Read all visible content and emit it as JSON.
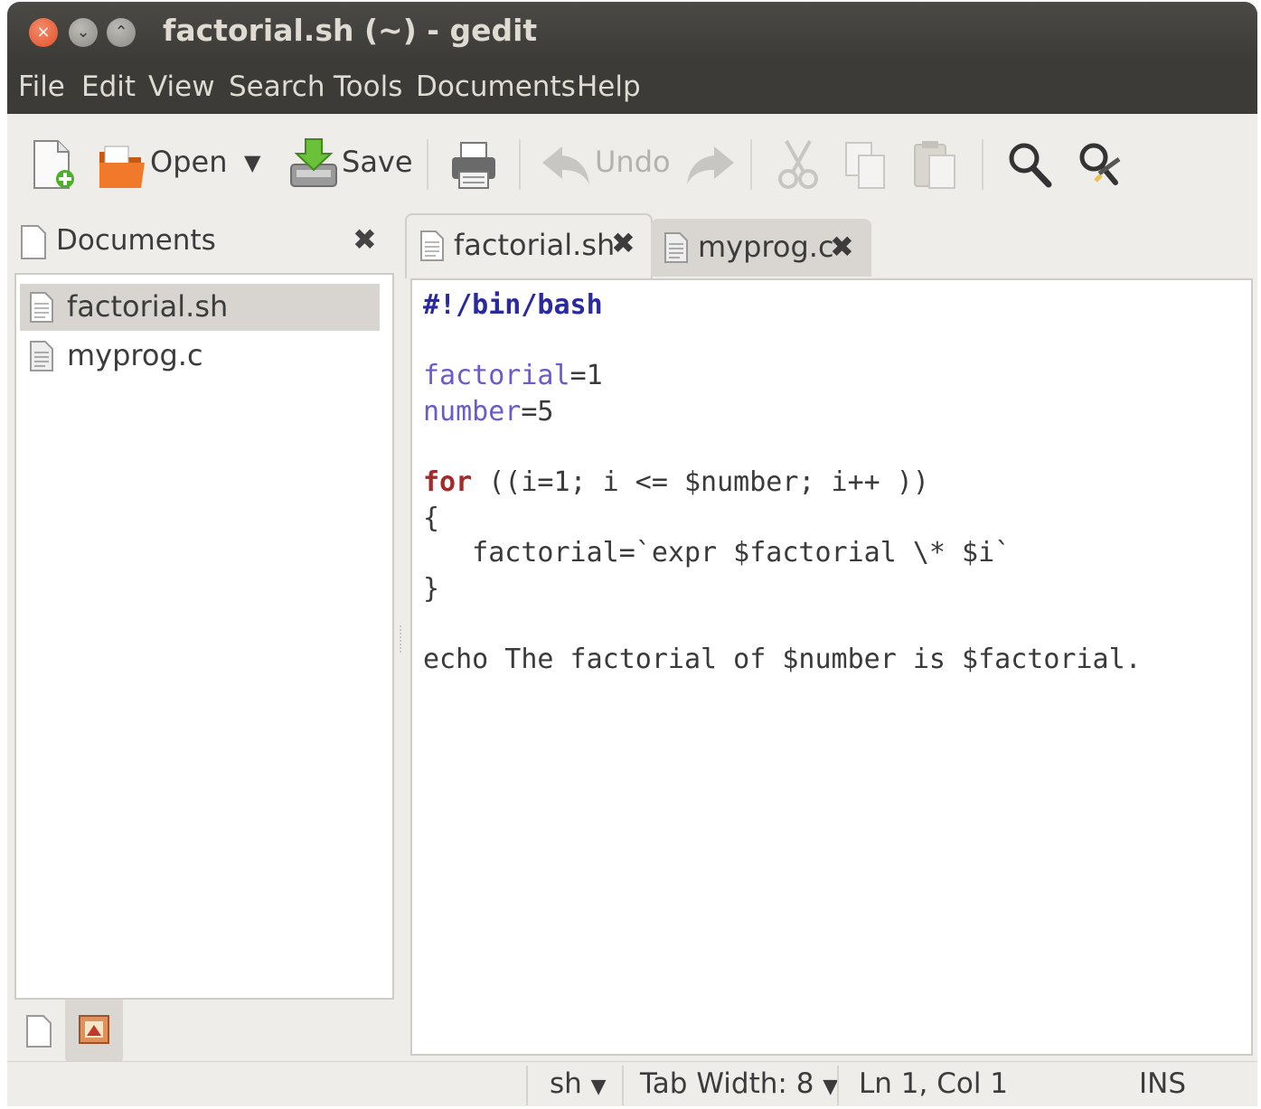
{
  "window": {
    "title": "factorial.sh (~) - gedit"
  },
  "menu": [
    "File",
    "Edit",
    "View",
    "Search",
    "Tools",
    "Documents",
    "Help"
  ],
  "toolbar": {
    "open_label": "Open",
    "save_label": "Save",
    "undo_label": "Undo",
    "dropdown_glyph": "▼"
  },
  "side_panel": {
    "title": "Documents",
    "close_glyph": "✖",
    "items": [
      {
        "label": "factorial.sh",
        "selected": true
      },
      {
        "label": "myprog.c",
        "selected": false
      }
    ]
  },
  "tabs": [
    {
      "label": "factorial.sh",
      "active": true,
      "close_glyph": "✖"
    },
    {
      "label": "myprog.c",
      "active": false,
      "close_glyph": "✖"
    }
  ],
  "code": {
    "shebang": "#!/bin/bash",
    "l3_var": "factorial",
    "l3_rest": "=1",
    "l4_var": "number",
    "l4_rest": "=5",
    "l6_kw": "for",
    "l6_rest": " ((i=1; i <= $number; i++ ))",
    "l7": "{",
    "l8": "   factorial=`expr $factorial \\* $i`",
    "l9": "}",
    "l11": "echo The factorial of $number is $factorial."
  },
  "colors": {
    "shebang": "#2a2aa0",
    "variable": "#6a5acd",
    "keyword": "#a52a2a",
    "text": "#3a3a3a"
  },
  "status": {
    "language": "sh",
    "tab_width": "Tab Width:  8",
    "position": "Ln 1, Col 1",
    "mode": "INS",
    "dropdown_glyph": "▼"
  }
}
